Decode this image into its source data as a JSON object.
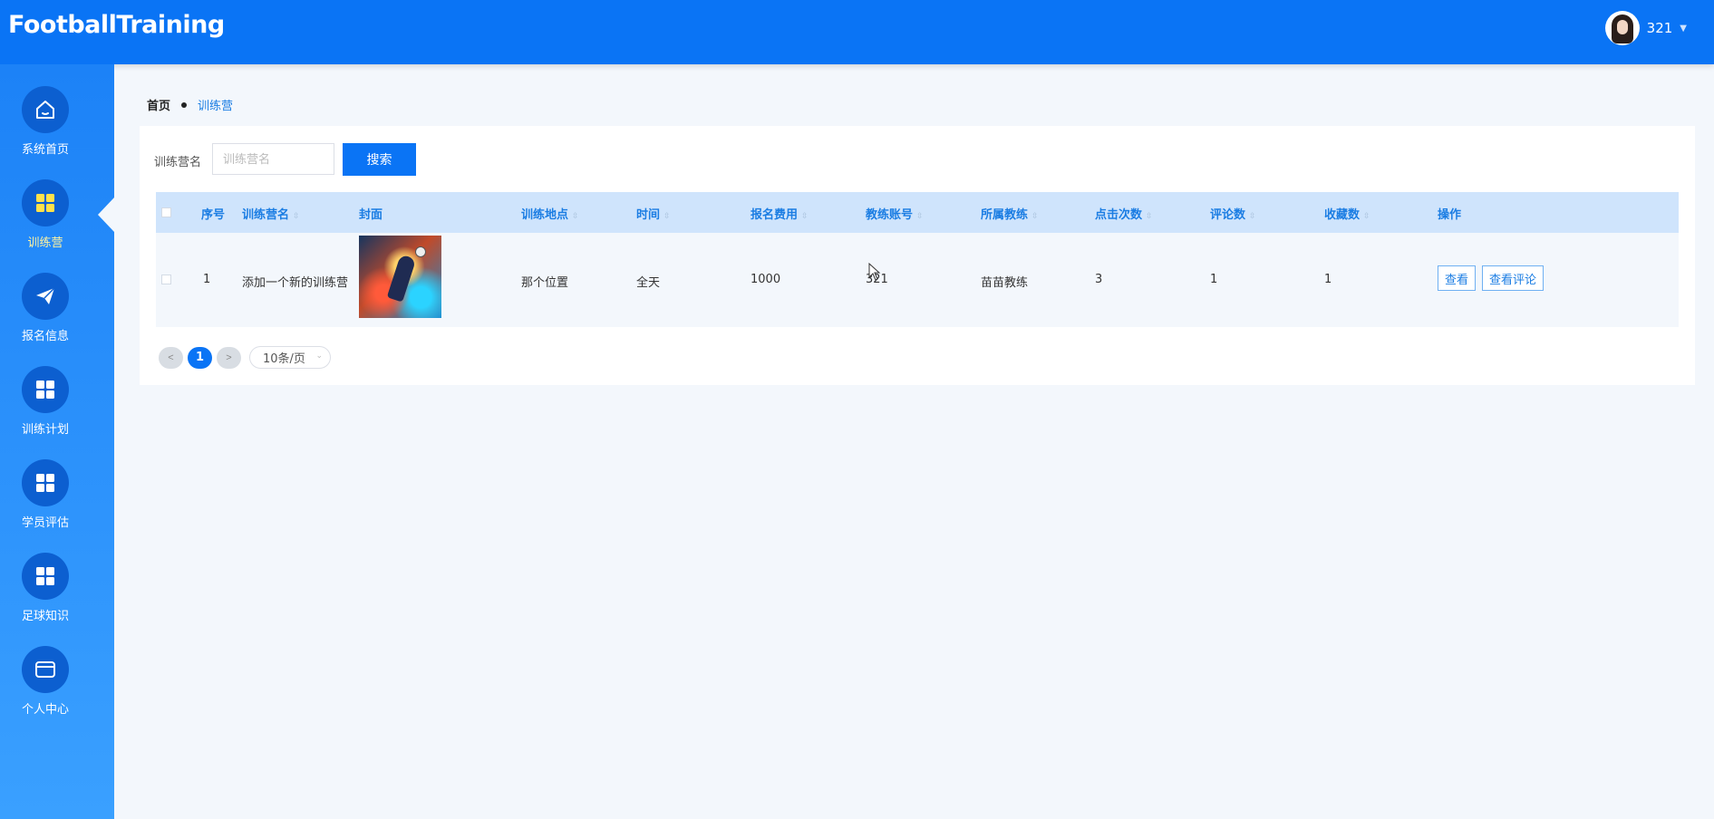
{
  "app": {
    "brand": "FootballTraining"
  },
  "user": {
    "name": "321"
  },
  "sidebar": {
    "items": [
      {
        "label": "系统首页",
        "icon": "home-icon"
      },
      {
        "label": "训练营",
        "icon": "grid-icon",
        "active": true
      },
      {
        "label": "报名信息",
        "icon": "paper-plane-icon"
      },
      {
        "label": "训练计划",
        "icon": "grid-icon"
      },
      {
        "label": "学员评估",
        "icon": "grid-icon"
      },
      {
        "label": "足球知识",
        "icon": "grid-icon"
      },
      {
        "label": "个人中心",
        "icon": "card-icon"
      }
    ]
  },
  "breadcrumb": {
    "home": "首页",
    "current": "训练营"
  },
  "search": {
    "label": "训练营名",
    "placeholder": "训练营名",
    "value": "",
    "button": "搜索"
  },
  "table": {
    "headers": [
      "序号",
      "训练营名",
      "封面",
      "训练地点",
      "时间",
      "报名费用",
      "教练账号",
      "所属教练",
      "点击次数",
      "评论数",
      "收藏数",
      "操作"
    ],
    "rows": [
      {
        "index": "1",
        "name": "添加一个新的训练营",
        "location": "那个位置",
        "time": "全天",
        "fee": "1000",
        "coach_account": "321",
        "coach": "苗苗教练",
        "clicks": "3",
        "comments": "1",
        "favorites": "1",
        "actions": [
          "查看",
          "查看评论"
        ]
      }
    ]
  },
  "pagination": {
    "prev": "<",
    "current": "1",
    "next": ">",
    "page_size": "10条/页"
  },
  "colors": {
    "primary": "#0a74f5",
    "header_bg": "#0a74f5",
    "table_header_bg": "#cfe4fc",
    "link": "#1b7de3",
    "active_label": "#fff3a0"
  }
}
